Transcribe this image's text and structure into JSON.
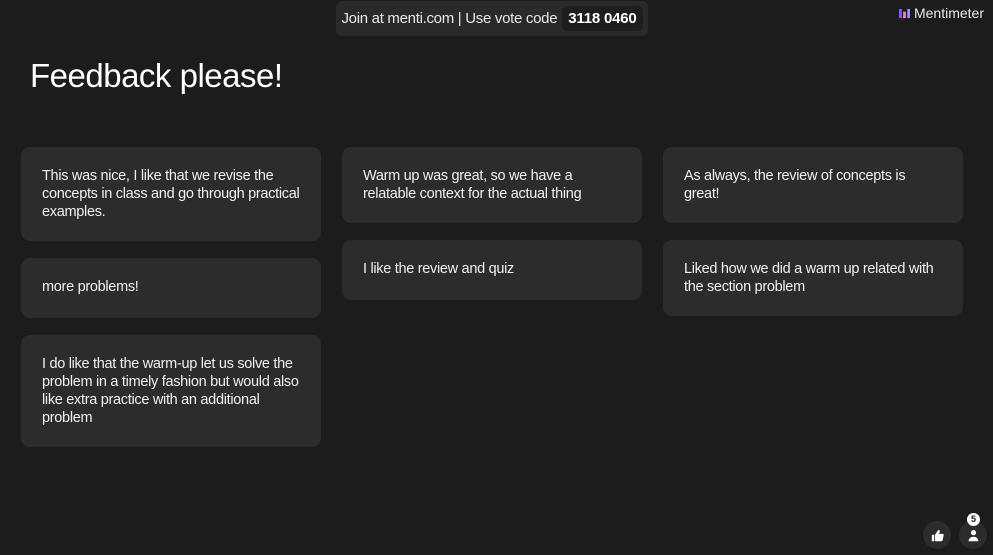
{
  "header": {
    "join_text": "Join at menti.com | Use vote code",
    "vote_code": "3118 0460",
    "brand": "Mentimeter"
  },
  "slide": {
    "title": "Feedback please!"
  },
  "responses": {
    "column_1": [
      "This was nice, I like that we revise the concepts in class and go through practical examples.",
      "more problems!",
      "I do like that the warm-up let us solve the problem in a timely fashion but would also like extra practice with an additional problem"
    ],
    "column_2": [
      "Warm up was great, so we have a relatable context for the actual thing",
      "I like the review and quiz"
    ],
    "column_3": [
      "As always, the review of concepts is great!",
      "Liked how we did a warm up related with the section problem"
    ]
  },
  "controls": {
    "participant_count": "5"
  },
  "colors": {
    "background": "#1c1c1c",
    "card": "#2c2c2c",
    "text": "#ffffff",
    "logo_accent": "#7b61ff"
  }
}
